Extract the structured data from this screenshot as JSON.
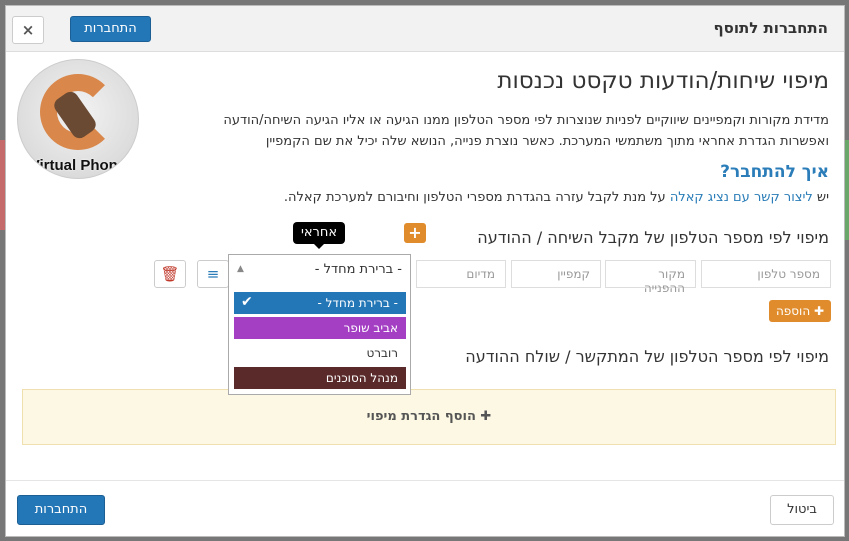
{
  "header": {
    "title": "התחברות לתוסף",
    "connect_label": "התחברות",
    "close_symbol": "×"
  },
  "logo": {
    "text": "Virtual Phone"
  },
  "main": {
    "title": "מיפוי שיחות/הודעות טקסט נכנסות",
    "desc_line1": "מדידת מקורות וקמפיינים שיווקיים לפניות שנוצרות לפי מספר הטלפון ממנו הגיעה או אליו הגיעה השיחה/הודעה",
    "desc_line2": "ואפשרות הגדרת אחראי מתוך משתמשי המערכת. כאשר נוצרת פנייה, הנושא שלה יכיל את שם הקמפיין",
    "how_title": "איך להתחבר?",
    "how_prefix": "יש ",
    "how_link": "ליצור קשר עם נציג קאלה",
    "how_suffix": " על מנת לקבל עזרה בהגדרת מספרי הטלפון וחיבורם למערכת קאלה."
  },
  "section1": {
    "title": "מיפוי לפי מספר הטלפון של מקבל השיחה / ההודעה",
    "fields": {
      "phone": "מספר טלפון",
      "source": "מקור ההפנייה",
      "campaign": "קמפיין",
      "medium": "מדיום"
    },
    "select_value": "- ברירת מחדל -",
    "tooltip": "אחראי",
    "options": [
      {
        "label": "- ברירת מחדל -",
        "bg": "#2477b7",
        "fg": "#ffffff",
        "selected": true
      },
      {
        "label": "אביב שופר",
        "bg": "#a43fc4",
        "fg": "#ffffff",
        "selected": false
      },
      {
        "label": "רוברט",
        "bg": "#ffffff",
        "fg": "#333333",
        "selected": false
      },
      {
        "label": "מנהל הסוכנים",
        "bg": "#5a2a2a",
        "fg": "#ffffff",
        "selected": false
      }
    ],
    "add_label": "הוספה"
  },
  "section2": {
    "title": "מיפוי לפי מספר הטלפון של המתקשר / שולח ההודעה",
    "add_mapping_label": "הוסף הגדרת מיפוי"
  },
  "footer": {
    "connect_label": "התחברות",
    "cancel_label": "ביטול"
  }
}
